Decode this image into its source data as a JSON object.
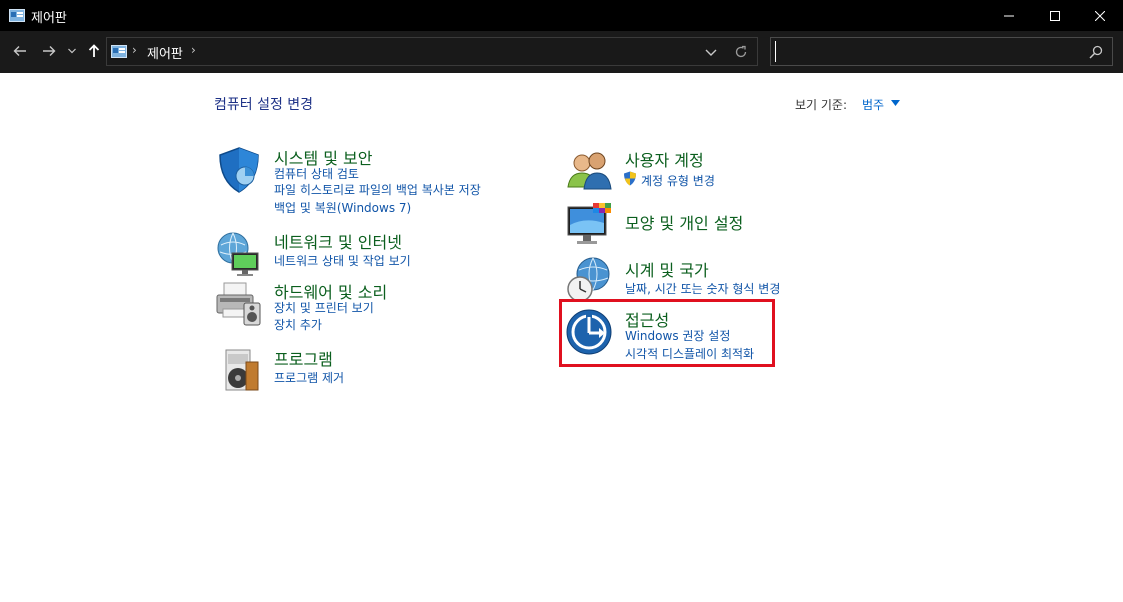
{
  "window": {
    "title": "제어판"
  },
  "address": {
    "crumb": "제어판",
    "sep": "›"
  },
  "search": {
    "placeholder": "",
    "value": ""
  },
  "content": {
    "title": "컴퓨터 설정 변경",
    "viewby_label": "보기 기준:",
    "viewby_value": "범주"
  },
  "categories": [
    {
      "icon": "shield-icon",
      "title": "시스템 및 보안",
      "links": [
        "컴퓨터 상태 검토",
        "파일 히스토리로 파일의 백업 복사본 저장",
        "백업 및 복원(Windows 7)"
      ]
    },
    {
      "icon": "network-icon",
      "title": "네트워크 및 인터넷",
      "links": [
        "네트워크 상태 및 작업 보기"
      ]
    },
    {
      "icon": "printer-icon",
      "title": "하드웨어 및 소리",
      "links": [
        "장치 및 프린터 보기",
        "장치 추가"
      ]
    },
    {
      "icon": "programs-icon",
      "title": "프로그램",
      "links": [
        "프로그램 제거"
      ]
    },
    {
      "icon": "users-icon",
      "title": "사용자 계정",
      "links": [
        "계정 유형 변경"
      ]
    },
    {
      "icon": "display-icon",
      "title": "모양 및 개인 설정",
      "links": []
    },
    {
      "icon": "clock-globe-icon",
      "title": "시계 및 국가",
      "links": [
        "날짜, 시간 또는 숫자 형식 변경"
      ]
    },
    {
      "icon": "accessibility-icon",
      "title": "접근성",
      "links": [
        "Windows 권장 설정",
        "시각적 디스플레이 최적화"
      ]
    }
  ],
  "colors": {
    "highlight": "#e0101f",
    "heading": "#0b5f1e",
    "link": "#1155a8"
  }
}
